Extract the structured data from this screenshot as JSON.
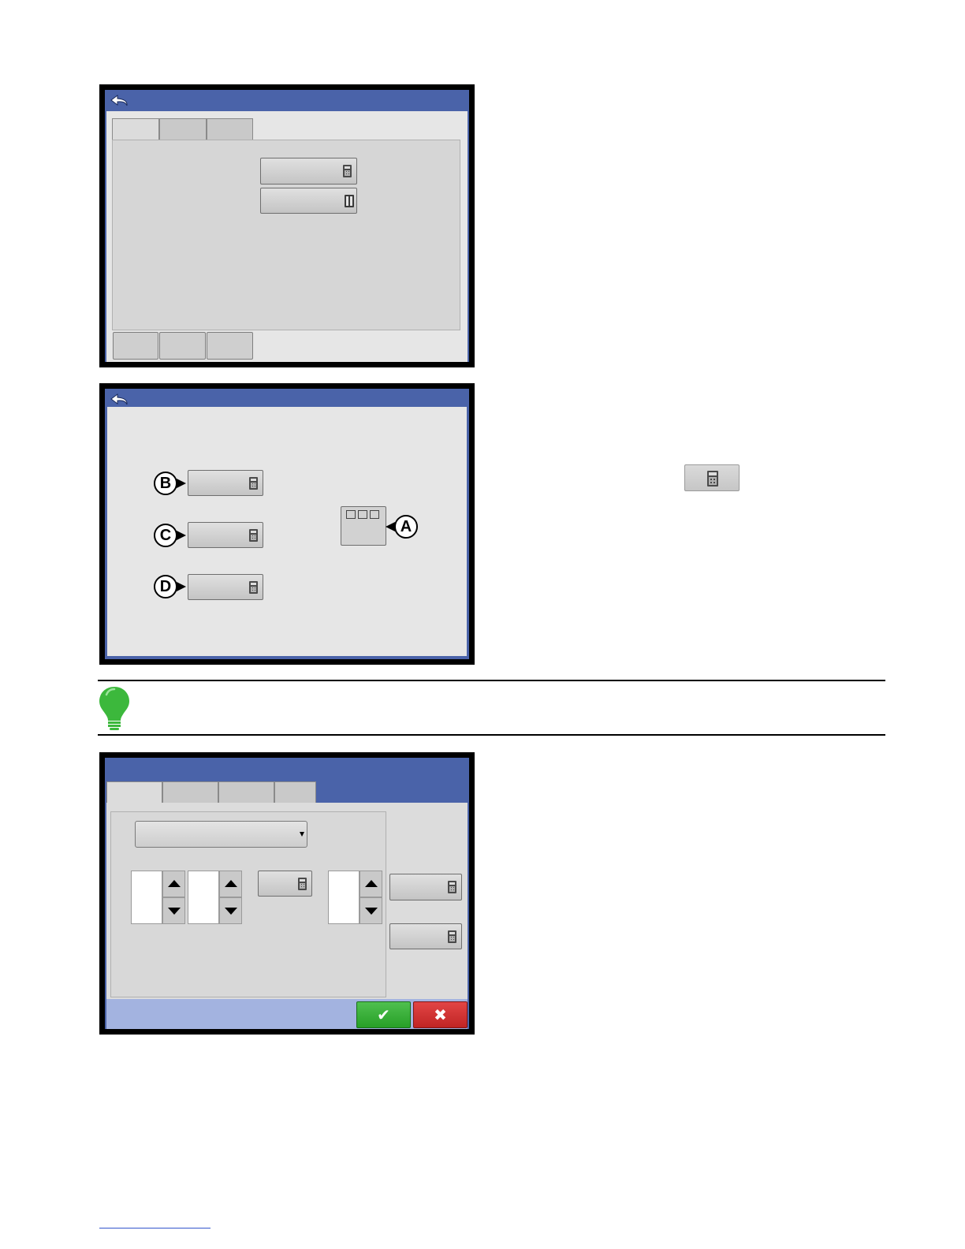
{
  "icons": {
    "back": "back-arrow-icon",
    "calculator": "calculator-icon",
    "columns": "columns-icon",
    "hint": "lightbulb-icon",
    "ok": "checkmark-icon",
    "cancel": "x-icon"
  },
  "screen2": {
    "callouts": {
      "a": "A",
      "b": "B",
      "c": "C",
      "d": "D"
    }
  },
  "buttons": {
    "ok_glyph": "✔",
    "cancel_glyph": "✖"
  },
  "colors": {
    "title_bar": "#4a63a9",
    "hint_green": "#3cb83c",
    "ok_green": "#27a027",
    "cancel_red": "#c02424"
  }
}
